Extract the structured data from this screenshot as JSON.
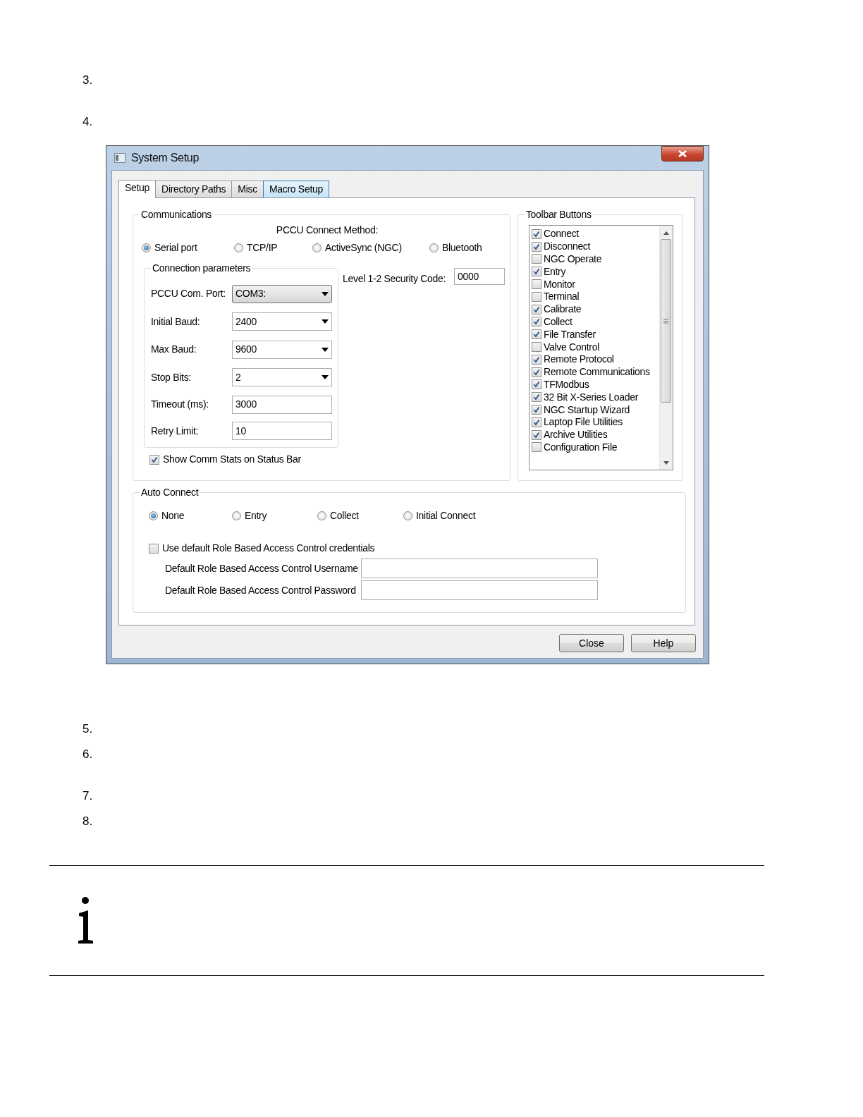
{
  "steps_before": [
    "3.",
    "4."
  ],
  "window": {
    "title": "System Setup"
  },
  "tabs": [
    {
      "label": "Setup",
      "selected": true
    },
    {
      "label": "Directory Paths",
      "selected": false
    },
    {
      "label": "Misc",
      "selected": false
    },
    {
      "label": "Macro Setup",
      "selected": false
    }
  ],
  "communications": {
    "title": "Communications",
    "method_label": "PCCU Connect Method:",
    "methods": [
      {
        "label": "Serial port",
        "selected": true
      },
      {
        "label": "TCP/IP",
        "selected": false
      },
      {
        "label": "ActiveSync (NGC)",
        "selected": false
      },
      {
        "label": "Bluetooth",
        "selected": false
      }
    ],
    "connection_parameters": {
      "title": "Connection parameters",
      "fields": [
        {
          "kind": "combo",
          "label": "PCCU Com. Port:",
          "value": "COM3:"
        },
        {
          "kind": "dropdown",
          "label": "Initial Baud:",
          "value": "2400"
        },
        {
          "kind": "dropdown",
          "label": "Max Baud:",
          "value": "9600"
        },
        {
          "kind": "dropdown",
          "label": "Stop Bits:",
          "value": "2"
        },
        {
          "kind": "text",
          "label": "Timeout (ms):",
          "value": "3000"
        },
        {
          "kind": "text",
          "label": "Retry Limit:",
          "value": "10"
        }
      ]
    },
    "security_code": {
      "label": "Level 1-2 Security Code:",
      "value": "0000"
    },
    "show_comm_stats": {
      "label": "Show Comm Stats on Status Bar",
      "checked": true
    }
  },
  "toolbar_buttons": {
    "title": "Toolbar Buttons",
    "items": [
      {
        "label": "Connect",
        "checked": true
      },
      {
        "label": "Disconnect",
        "checked": true
      },
      {
        "label": "NGC Operate",
        "checked": false
      },
      {
        "label": "Entry",
        "checked": true
      },
      {
        "label": "Monitor",
        "checked": false
      },
      {
        "label": "Terminal",
        "checked": false
      },
      {
        "label": "Calibrate",
        "checked": true
      },
      {
        "label": "Collect",
        "checked": true
      },
      {
        "label": "File Transfer",
        "checked": true
      },
      {
        "label": "Valve Control",
        "checked": false
      },
      {
        "label": "Remote Protocol",
        "checked": true
      },
      {
        "label": "Remote Communications",
        "checked": true
      },
      {
        "label": "TFModbus",
        "checked": true
      },
      {
        "label": "32 Bit X-Series Loader",
        "checked": true
      },
      {
        "label": "NGC Startup Wizard",
        "checked": true
      },
      {
        "label": "Laptop File Utilities",
        "checked": true
      },
      {
        "label": "Archive Utilities",
        "checked": true
      },
      {
        "label": "Configuration File",
        "checked": false
      }
    ]
  },
  "auto_connect": {
    "title": "Auto Connect",
    "options": [
      {
        "label": "None",
        "selected": true
      },
      {
        "label": "Entry",
        "selected": false
      },
      {
        "label": "Collect",
        "selected": false
      },
      {
        "label": "Initial Connect",
        "selected": false
      }
    ],
    "use_default_rbac": {
      "label": "Use default Role Based Access Control credentials",
      "checked": false
    },
    "fields": [
      {
        "label": "Default Role Based Access Control Username"
      },
      {
        "label": "Default Role Based Access Control Password"
      }
    ]
  },
  "buttons": [
    "Close",
    "Help"
  ],
  "steps_after": [
    "5.",
    "6.",
    "7.",
    "8."
  ]
}
